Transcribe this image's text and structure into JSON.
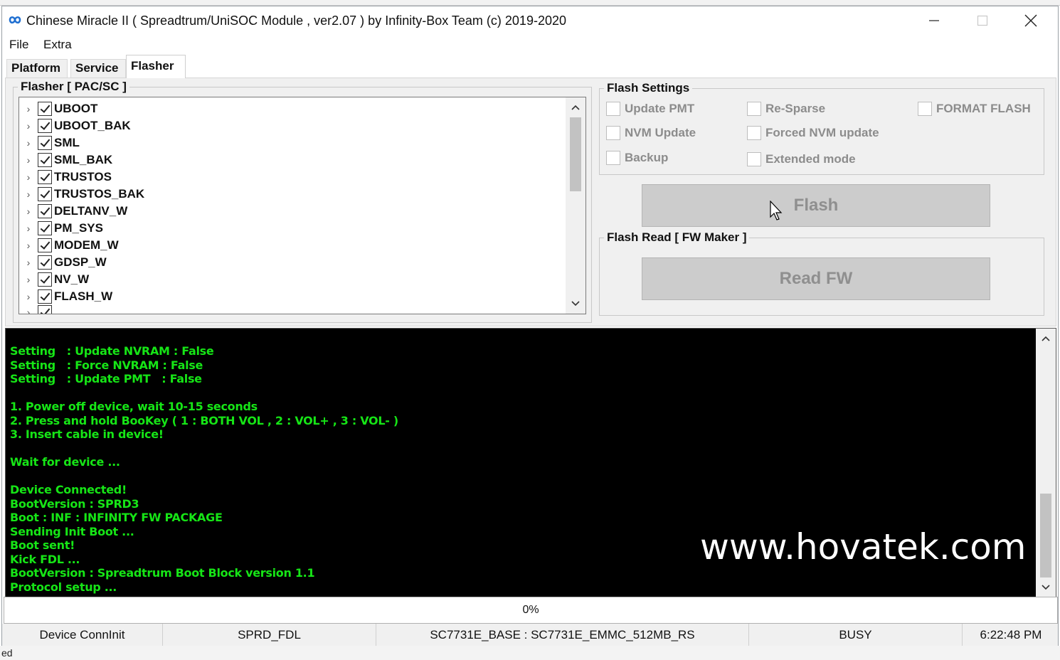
{
  "window": {
    "title": "Chinese Miracle II ( Spreadtrum/UniSOC Module , ver2.07  ) by Infinity-Box Team (c) 2019-2020",
    "icon": "infinity-icon"
  },
  "menu": [
    "File",
    "Extra"
  ],
  "tabs": [
    {
      "label": "Platform",
      "active": false
    },
    {
      "label": "Service",
      "active": false
    },
    {
      "label": "Flasher",
      "active": true
    }
  ],
  "flasher_group": {
    "title": "Flasher [ PAC/SC ]",
    "items": [
      {
        "label": "UBOOT",
        "checked": true
      },
      {
        "label": "UBOOT_BAK",
        "checked": true
      },
      {
        "label": "SML",
        "checked": true
      },
      {
        "label": "SML_BAK",
        "checked": true
      },
      {
        "label": "TRUSTOS",
        "checked": true
      },
      {
        "label": "TRUSTOS_BAK",
        "checked": true
      },
      {
        "label": "DELTANV_W",
        "checked": true
      },
      {
        "label": "PM_SYS",
        "checked": true
      },
      {
        "label": "MODEM_W",
        "checked": true
      },
      {
        "label": "GDSP_W",
        "checked": true
      },
      {
        "label": "NV_W",
        "checked": true
      },
      {
        "label": "FLASH_W",
        "checked": true
      }
    ]
  },
  "flash_settings": {
    "title": "Flash Settings",
    "options": {
      "update_pmt": {
        "label": "Update PMT",
        "checked": false
      },
      "re_sparse": {
        "label": "Re-Sparse",
        "checked": false
      },
      "format_flash": {
        "label": "FORMAT FLASH",
        "checked": false
      },
      "nvm_update": {
        "label": "NVM Update",
        "checked": false
      },
      "forced_nvm_update": {
        "label": "Forced NVM update",
        "checked": false
      },
      "backup": {
        "label": "Backup",
        "checked": false
      },
      "extended_mode": {
        "label": "Extended mode",
        "checked": false
      }
    },
    "flash_button": "Flash"
  },
  "flash_read": {
    "title": "Flash Read [ FW Maker ]",
    "read_button": "Read FW"
  },
  "log": {
    "lines": [
      "Setting   : Update NVRAM : False",
      "Setting   : Force NVRAM : False",
      "Setting   : Update PMT   : False",
      "",
      "1. Power off device, wait 10-15 seconds",
      "2. Press and hold BooKey ( 1 : BOTH VOL , 2 : VOL+ , 3 : VOL- )",
      "3. Insert cable in device!",
      "",
      "Wait for device ...",
      "",
      "Device Connected!",
      "BootVersion : SPRD3",
      "Boot : INF : INFINITY FW PACKAGE",
      "Sending Init Boot ...",
      "Boot sent!",
      "Kick FDL ...",
      "BootVersion : Spreadtrum Boot Block version 1.1",
      "Protocol setup ..."
    ],
    "text_color": "#16e516",
    "watermark": "www.hovatek.com"
  },
  "progress": {
    "text": "0%",
    "value": 0
  },
  "status": {
    "state": "Device ConnInit",
    "mode": "SPRD_FDL",
    "chip": "SC7731E_BASE : SC7731E_EMMC_512MB_RS",
    "busy": "BUSY",
    "time": "6:22:48 PM"
  },
  "background_taskbar_text": "ed"
}
